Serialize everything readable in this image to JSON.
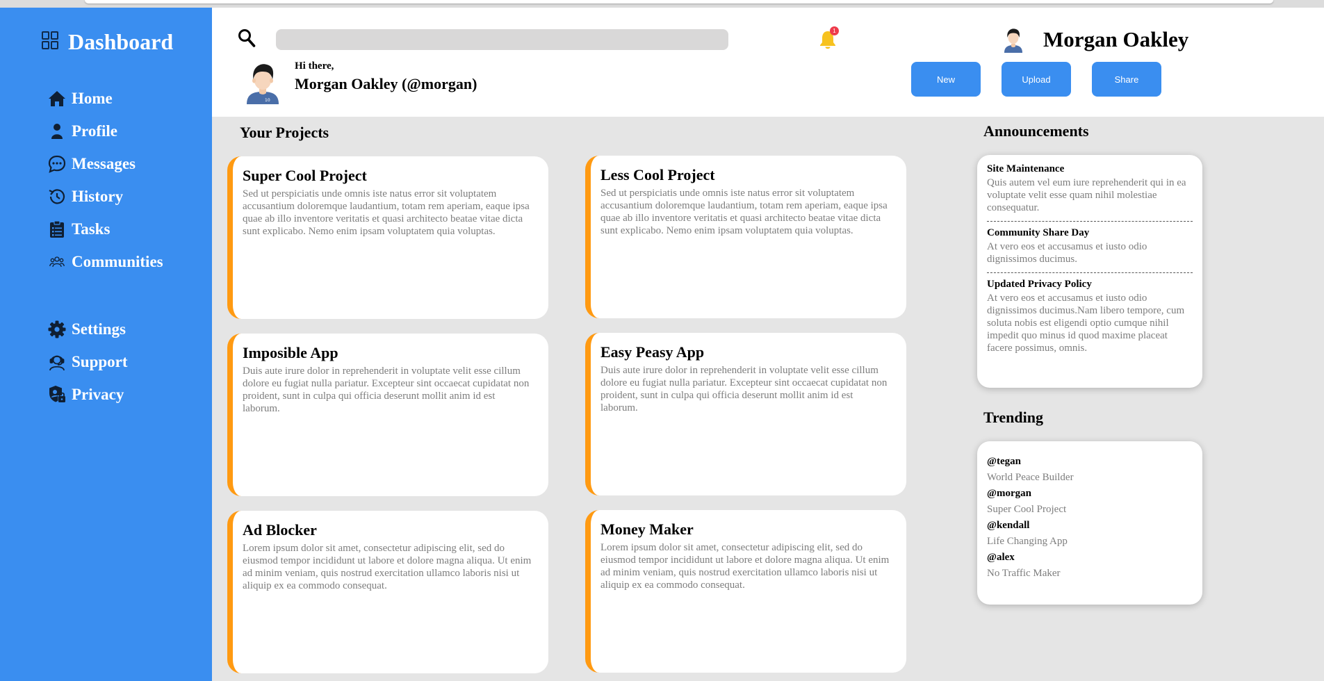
{
  "sidebar": {
    "brand": "Dashboard",
    "nav": [
      {
        "label": "Home",
        "icon": "home-icon"
      },
      {
        "label": "Profile",
        "icon": "user-icon"
      },
      {
        "label": "Messages",
        "icon": "chat-icon"
      },
      {
        "label": "History",
        "icon": "history-icon"
      },
      {
        "label": "Tasks",
        "icon": "clipboard-icon"
      },
      {
        "label": "Communities",
        "icon": "people-icon"
      }
    ],
    "secondary": [
      {
        "label": "Settings",
        "icon": "gear-icon"
      },
      {
        "label": "Support",
        "icon": "support-icon"
      },
      {
        "label": "Privacy",
        "icon": "shield-lock-icon"
      }
    ]
  },
  "header": {
    "search_placeholder": "",
    "notification_count": "1",
    "user_name": "Morgan Oakley",
    "greeting": "Hi there,",
    "greeting_name": "Morgan Oakley (@morgan)",
    "buttons": {
      "new": "New",
      "upload": "Upload",
      "share": "Share"
    }
  },
  "projects": {
    "title": "Your Projects",
    "items": [
      {
        "title": "Super Cool Project",
        "desc": "Sed ut perspiciatis unde omnis iste natus error sit voluptatem accusantium doloremque laudantium, totam rem aperiam, eaque ipsa quae ab illo inventore veritatis et quasi architecto beatae vitae dicta sunt explicabo. Nemo enim ipsam voluptatem quia voluptas."
      },
      {
        "title": "Less Cool Project",
        "desc": "Sed ut perspiciatis unde omnis iste natus error sit voluptatem accusantium doloremque laudantium, totam rem aperiam, eaque ipsa quae ab illo inventore veritatis et quasi architecto beatae vitae dicta sunt explicabo. Nemo enim ipsam voluptatem quia voluptas."
      },
      {
        "title": "Imposible App",
        "desc": "Duis aute irure dolor in reprehenderit in voluptate velit esse cillum dolore eu fugiat nulla pariatur. Excepteur sint occaecat cupidatat non proident, sunt in culpa qui officia deserunt mollit anim id est laborum."
      },
      {
        "title": "Easy Peasy App",
        "desc": "Duis aute irure dolor in reprehenderit in voluptate velit esse cillum dolore eu fugiat nulla pariatur. Excepteur sint occaecat cupidatat non proident, sunt in culpa qui officia deserunt mollit anim id est laborum."
      },
      {
        "title": "Ad Blocker",
        "desc": "Lorem ipsum dolor sit amet, consectetur adipiscing elit, sed do eiusmod tempor incididunt ut labore et dolore magna aliqua. Ut enim ad minim veniam, quis nostrud exercitation ullamco laboris nisi ut aliquip ex ea commodo consequat."
      },
      {
        "title": "Money Maker",
        "desc": "Lorem ipsum dolor sit amet, consectetur adipiscing elit, sed do eiusmod tempor incididunt ut labore et dolore magna aliqua. Ut enim ad minim veniam, quis nostrud exercitation ullamco laboris nisi ut aliquip ex ea commodo consequat."
      }
    ]
  },
  "announcements": {
    "title": "Announcements",
    "items": [
      {
        "title": "Site Maintenance",
        "desc": "Quis autem vel eum iure reprehenderit qui in ea voluptate velit esse quam nihil molestiae consequatur."
      },
      {
        "title": "Community Share Day",
        "desc": "At vero eos et accusamus et iusto odio dignissimos ducimus."
      },
      {
        "title": "Updated Privacy Policy",
        "desc": "At vero eos et accusamus et iusto odio dignissimos ducimus.Nam libero tempore, cum soluta nobis est eligendi optio cumque nihil impedit quo minus id quod maxime placeat facere possimus, omnis."
      }
    ]
  },
  "trending": {
    "title": "Trending",
    "items": [
      {
        "user": "@tegan",
        "project": "World Peace Builder"
      },
      {
        "user": "@morgan",
        "project": "Super Cool Project"
      },
      {
        "user": "@kendall",
        "project": "Life Changing App"
      },
      {
        "user": "@alex",
        "project": "No Traffic Maker"
      }
    ]
  },
  "colors": {
    "accent": "#3a8ef0",
    "card_border": "#ff9a12",
    "background": "#e5e5e5",
    "badge": "#ee3b4b"
  }
}
